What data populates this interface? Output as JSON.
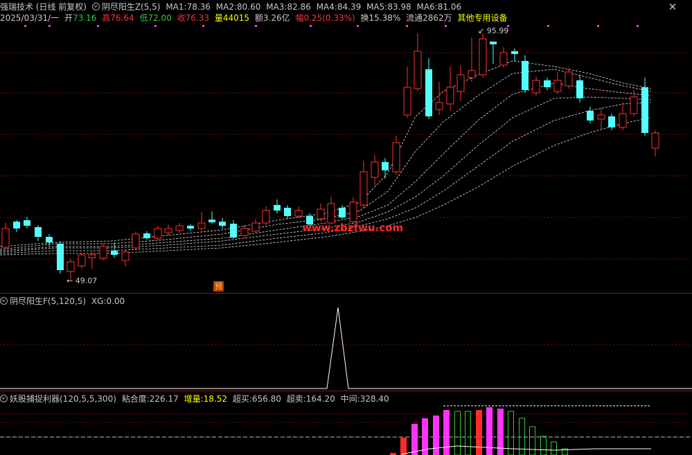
{
  "header": {
    "title": "强瑞技术 (日线 前复权)",
    "indicator": "阴尽阳生Z(5,5)",
    "ma": [
      {
        "label": "MA1:",
        "value": "78.36"
      },
      {
        "label": "MA2:",
        "value": "80.60"
      },
      {
        "label": "MA3:",
        "value": "82.86"
      },
      {
        "label": "MA4:",
        "value": "84.39"
      },
      {
        "label": "MA5:",
        "value": "83.98"
      },
      {
        "label": "MA6:",
        "value": "81.06"
      }
    ]
  },
  "quote": {
    "date": "2025/03/31/一",
    "open_label": "开",
    "open": "73.16",
    "high_label": "高",
    "high": "76.64",
    "low_label": "低",
    "low": "72.00",
    "close_label": "收",
    "close": "76.33",
    "vol_label": "量",
    "vol": "44015",
    "amt_label": "额",
    "amt": "3.26亿",
    "chg_label": "幅",
    "chg": "0.25(0.33%)",
    "turn_label": "换",
    "turn": "15.38%",
    "float_label": "流通",
    "float": "2862万",
    "other": "其他专用设备"
  },
  "annotations": {
    "max_price": "95.99",
    "min_price": "49.07",
    "pre_badge": "预",
    "watermark": "www.zbzfwu.com"
  },
  "panel2": {
    "name": "阴尽阳生F(5,120,5)",
    "xg_label": "XG:",
    "xg_value": "0.00"
  },
  "panel3": {
    "name": "妖股捕捉利器(120,5,5,300)",
    "items": [
      {
        "label": "粘合度:",
        "value": "226.17"
      },
      {
        "label": "增量:",
        "value": "18.52"
      },
      {
        "label": "超买:",
        "value": "656.80"
      },
      {
        "label": "超卖:",
        "value": "164.20"
      },
      {
        "label": "中间:",
        "value": "328.40"
      }
    ]
  },
  "colors": {
    "up": "#ff3232",
    "down": "#54ffff",
    "magenta": "#ff33ff",
    "green": "#33cc33",
    "yellow": "#ffff00",
    "grid": "#7a1010"
  },
  "icons": {
    "close": "close-icon",
    "indicator": "indicator-icon"
  }
}
